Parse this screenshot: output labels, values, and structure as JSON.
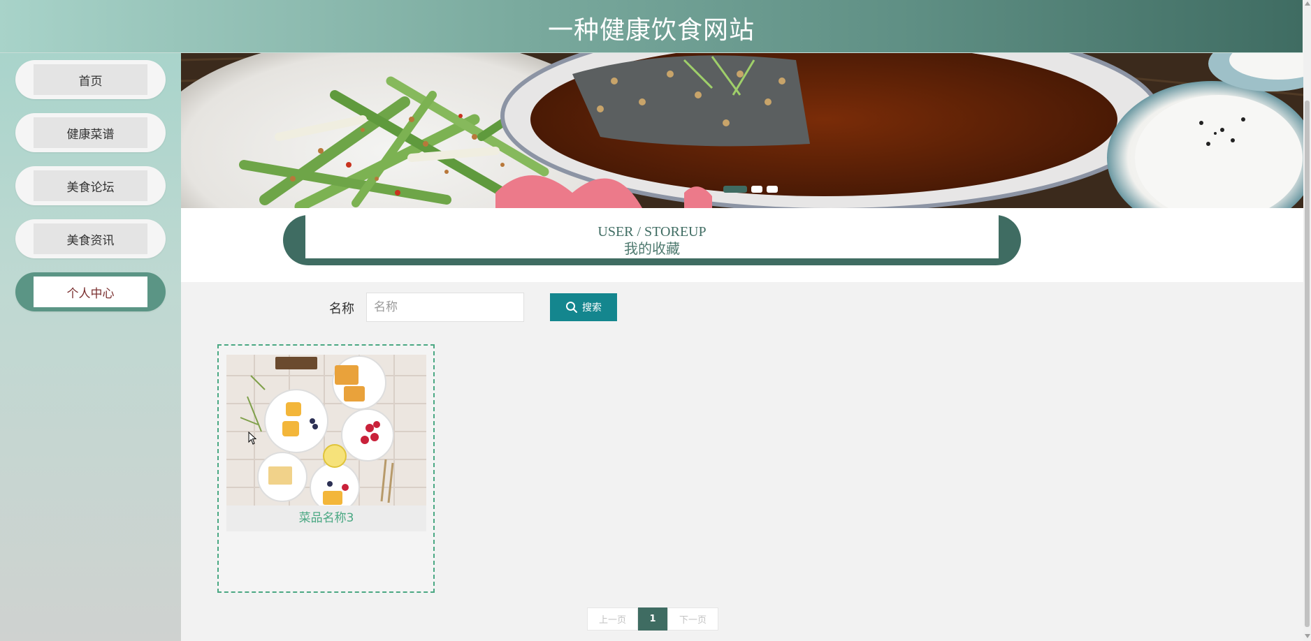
{
  "header": {
    "title": "一种健康饮食网站"
  },
  "sidebar": {
    "items": [
      {
        "label": "首页",
        "active": false
      },
      {
        "label": "健康菜谱",
        "active": false
      },
      {
        "label": "美食论坛",
        "active": false
      },
      {
        "label": "美食资讯",
        "active": false
      },
      {
        "label": "个人中心",
        "active": true
      }
    ]
  },
  "banner": {
    "slides": 3,
    "active_slide": 1
  },
  "section": {
    "title_en": "USER / STOREUP",
    "title_cn": "我的收藏"
  },
  "search": {
    "label": "名称",
    "placeholder": "名称",
    "value": "",
    "button_label": "搜索",
    "button_icon": "search-icon"
  },
  "favorites": [
    {
      "name": "菜品名称3"
    }
  ],
  "pagination": {
    "prev_label": "上一页",
    "current_page": "1",
    "next_label": "下一页"
  },
  "colors": {
    "primary": "#3f6c62",
    "search_button": "#14868e",
    "card_accent": "#4aa883",
    "active_nav_text": "#7a2f2f"
  }
}
